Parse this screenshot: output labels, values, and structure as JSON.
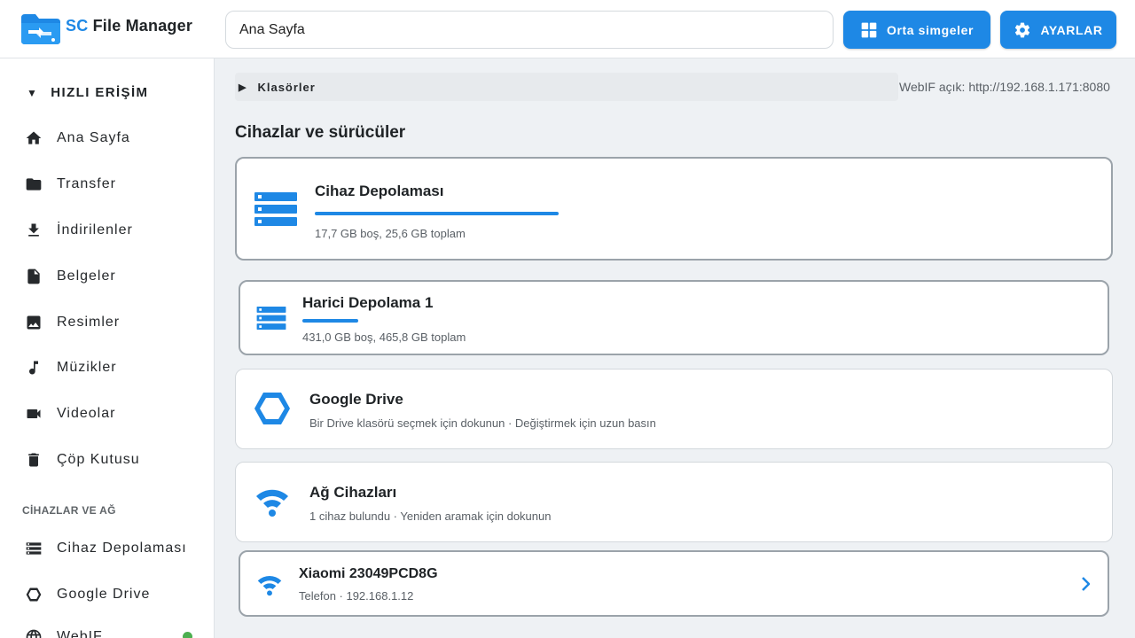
{
  "header": {
    "app_name_prefix": "SC",
    "app_name_rest": " File Manager",
    "path_value": "Ana Sayfa",
    "view_button_label": "Orta simgeler",
    "settings_button_label": "AYARLAR"
  },
  "sidebar": {
    "quick_access_title": "HIZLI ERİŞİM",
    "items": [
      {
        "label": "Ana Sayfa",
        "icon": "home-icon"
      },
      {
        "label": "Transfer",
        "icon": "folder-icon"
      },
      {
        "label": "İndirilenler",
        "icon": "download-icon"
      },
      {
        "label": "Belgeler",
        "icon": "document-icon"
      },
      {
        "label": "Resimler",
        "icon": "image-icon"
      },
      {
        "label": "Müzikler",
        "icon": "music-note-icon"
      },
      {
        "label": "Videolar",
        "icon": "videocam-icon"
      },
      {
        "label": "Çöp Kutusu",
        "icon": "trash-icon"
      }
    ],
    "devices_title": "CİHAZLAR VE AĞ",
    "device_items": [
      {
        "label": "Cihaz Depolaması",
        "icon": "storage-icon"
      },
      {
        "label": "Google Drive",
        "icon": "drive-hexagon-icon"
      },
      {
        "label": "WebIF",
        "icon": "globe-icon"
      }
    ]
  },
  "main": {
    "folders_label": "Klasörler",
    "webif_status": "WebIF açık: http://192.168.1.171:8080",
    "section_title": "Cihazlar ve sürücüler",
    "cards": [
      {
        "title": "Cihaz Depolaması",
        "subtitle": "17,7 GB boş, 25,6 GB toplam",
        "icon": "storage-icon",
        "used_fraction": 0.31
      },
      {
        "title": "Harici Depolama 1",
        "subtitle": "431,0 GB boş, 465,8 GB toplam",
        "icon": "storage-icon",
        "used_fraction": 0.07
      },
      {
        "title": "Google Drive",
        "subtitle": "Bir Drive klasörü seçmek için dokunun · Değiştirmek için uzun basın",
        "icon": "drive-hexagon-icon"
      },
      {
        "title": "Ağ Cihazları",
        "subtitle": "1 cihaz bulundu · Yeniden aramak için dokunun",
        "icon": "wifi-icon"
      },
      {
        "title": "Xiaomi 23049PCD8G",
        "subtitle": "Telefon · 192.168.1.12",
        "icon": "wifi-icon"
      }
    ]
  },
  "colors": {
    "accent": "#1e88e5",
    "webif_status_dot": "#4caf50"
  }
}
